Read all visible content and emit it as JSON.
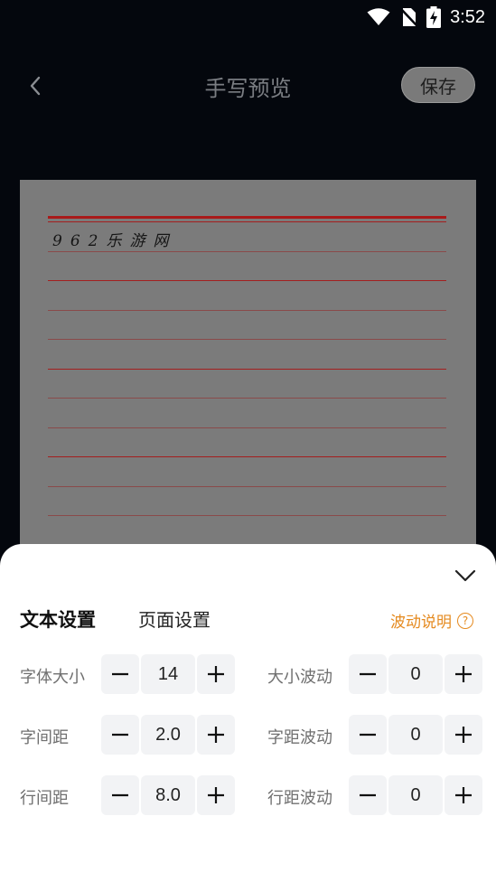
{
  "status": {
    "time": "3:52"
  },
  "header": {
    "title": "手写预览",
    "save_label": "保存"
  },
  "preview": {
    "text": "962乐游网"
  },
  "sheet": {
    "tabs": [
      {
        "label": "文本设置",
        "active": true
      },
      {
        "label": "页面设置",
        "active": false
      }
    ],
    "help_label": "波动说明",
    "help_icon": "?",
    "rows": [
      {
        "left": {
          "label": "字体大小",
          "value": "14"
        },
        "right": {
          "label": "大小波动",
          "value": "0"
        }
      },
      {
        "left": {
          "label": "字间距",
          "value": "2.0"
        },
        "right": {
          "label": "字距波动",
          "value": "0"
        }
      },
      {
        "left": {
          "label": "行间距",
          "value": "8.0"
        },
        "right": {
          "label": "行距波动",
          "value": "0"
        }
      }
    ]
  },
  "colors": {
    "accent": "#e58a1f",
    "rule": "#a41e1e"
  }
}
